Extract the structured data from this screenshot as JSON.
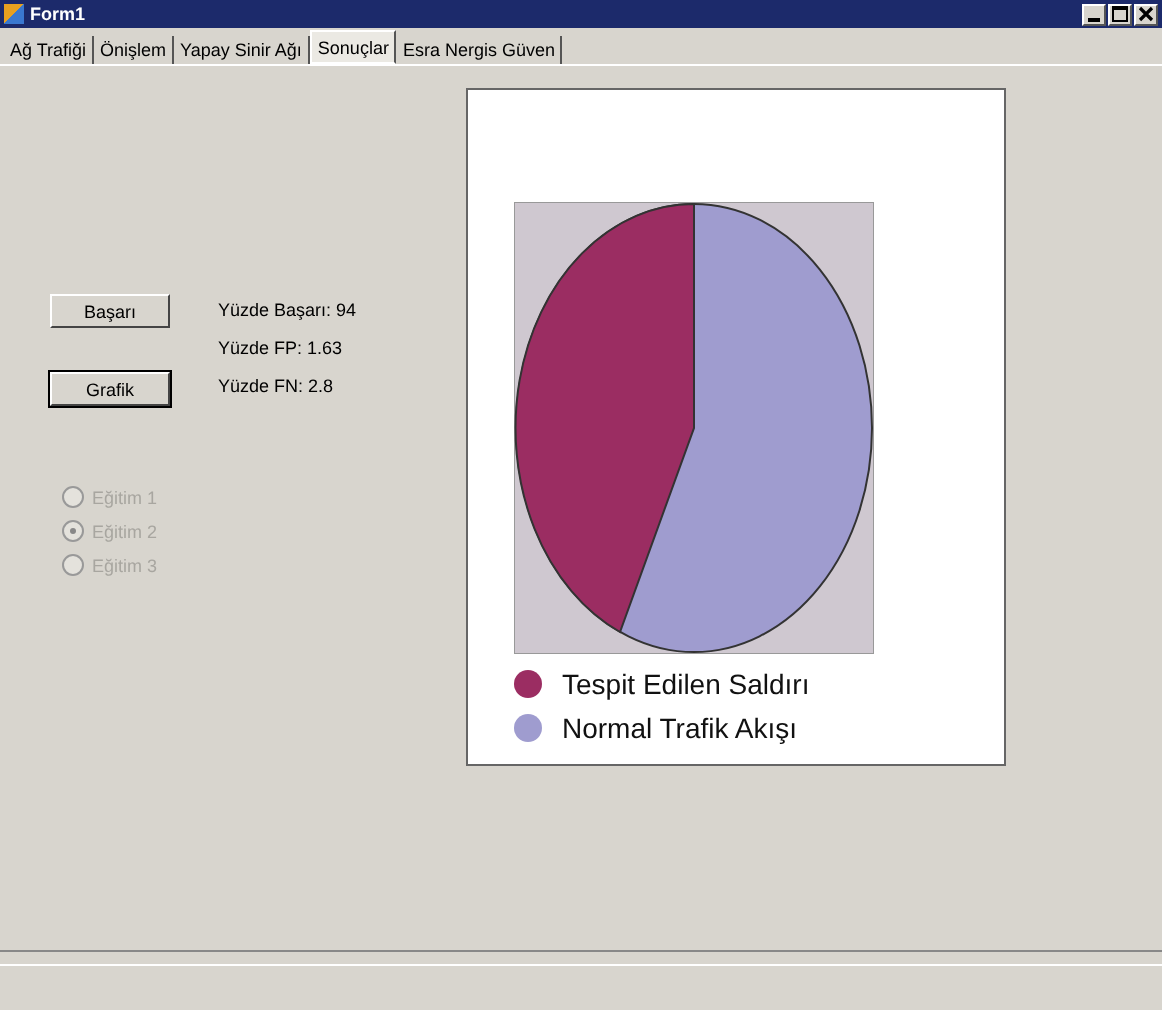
{
  "window": {
    "title": "Form1"
  },
  "tabs": [
    {
      "label": "Ağ Trafiği",
      "selected": false
    },
    {
      "label": "Önişlem",
      "selected": false
    },
    {
      "label": "Yapay Sinir Ağı",
      "selected": false
    },
    {
      "label": "Sonuçlar",
      "selected": true
    },
    {
      "label": "Esra Nergis Güven",
      "selected": false
    }
  ],
  "buttons": [
    {
      "label": "Başarı",
      "focused": false
    },
    {
      "label": "Grafik",
      "focused": true
    }
  ],
  "results": [
    "Yüzde Başarı: 94",
    "Yüzde FP: 1.63",
    "Yüzde FN: 2.8"
  ],
  "radios": [
    {
      "label": "Eğitim 1",
      "selected": false,
      "disabled": true
    },
    {
      "label": "Eğitim 2",
      "selected": true,
      "disabled": true
    },
    {
      "label": "Eğitim 3",
      "selected": false,
      "disabled": true
    }
  ],
  "legend": [
    {
      "label": "Tespit Edilen Saldırı",
      "color": "#9b2d62"
    },
    {
      "label": "Normal Trafik Akışı",
      "color": "#9f9ccf"
    }
  ]
}
